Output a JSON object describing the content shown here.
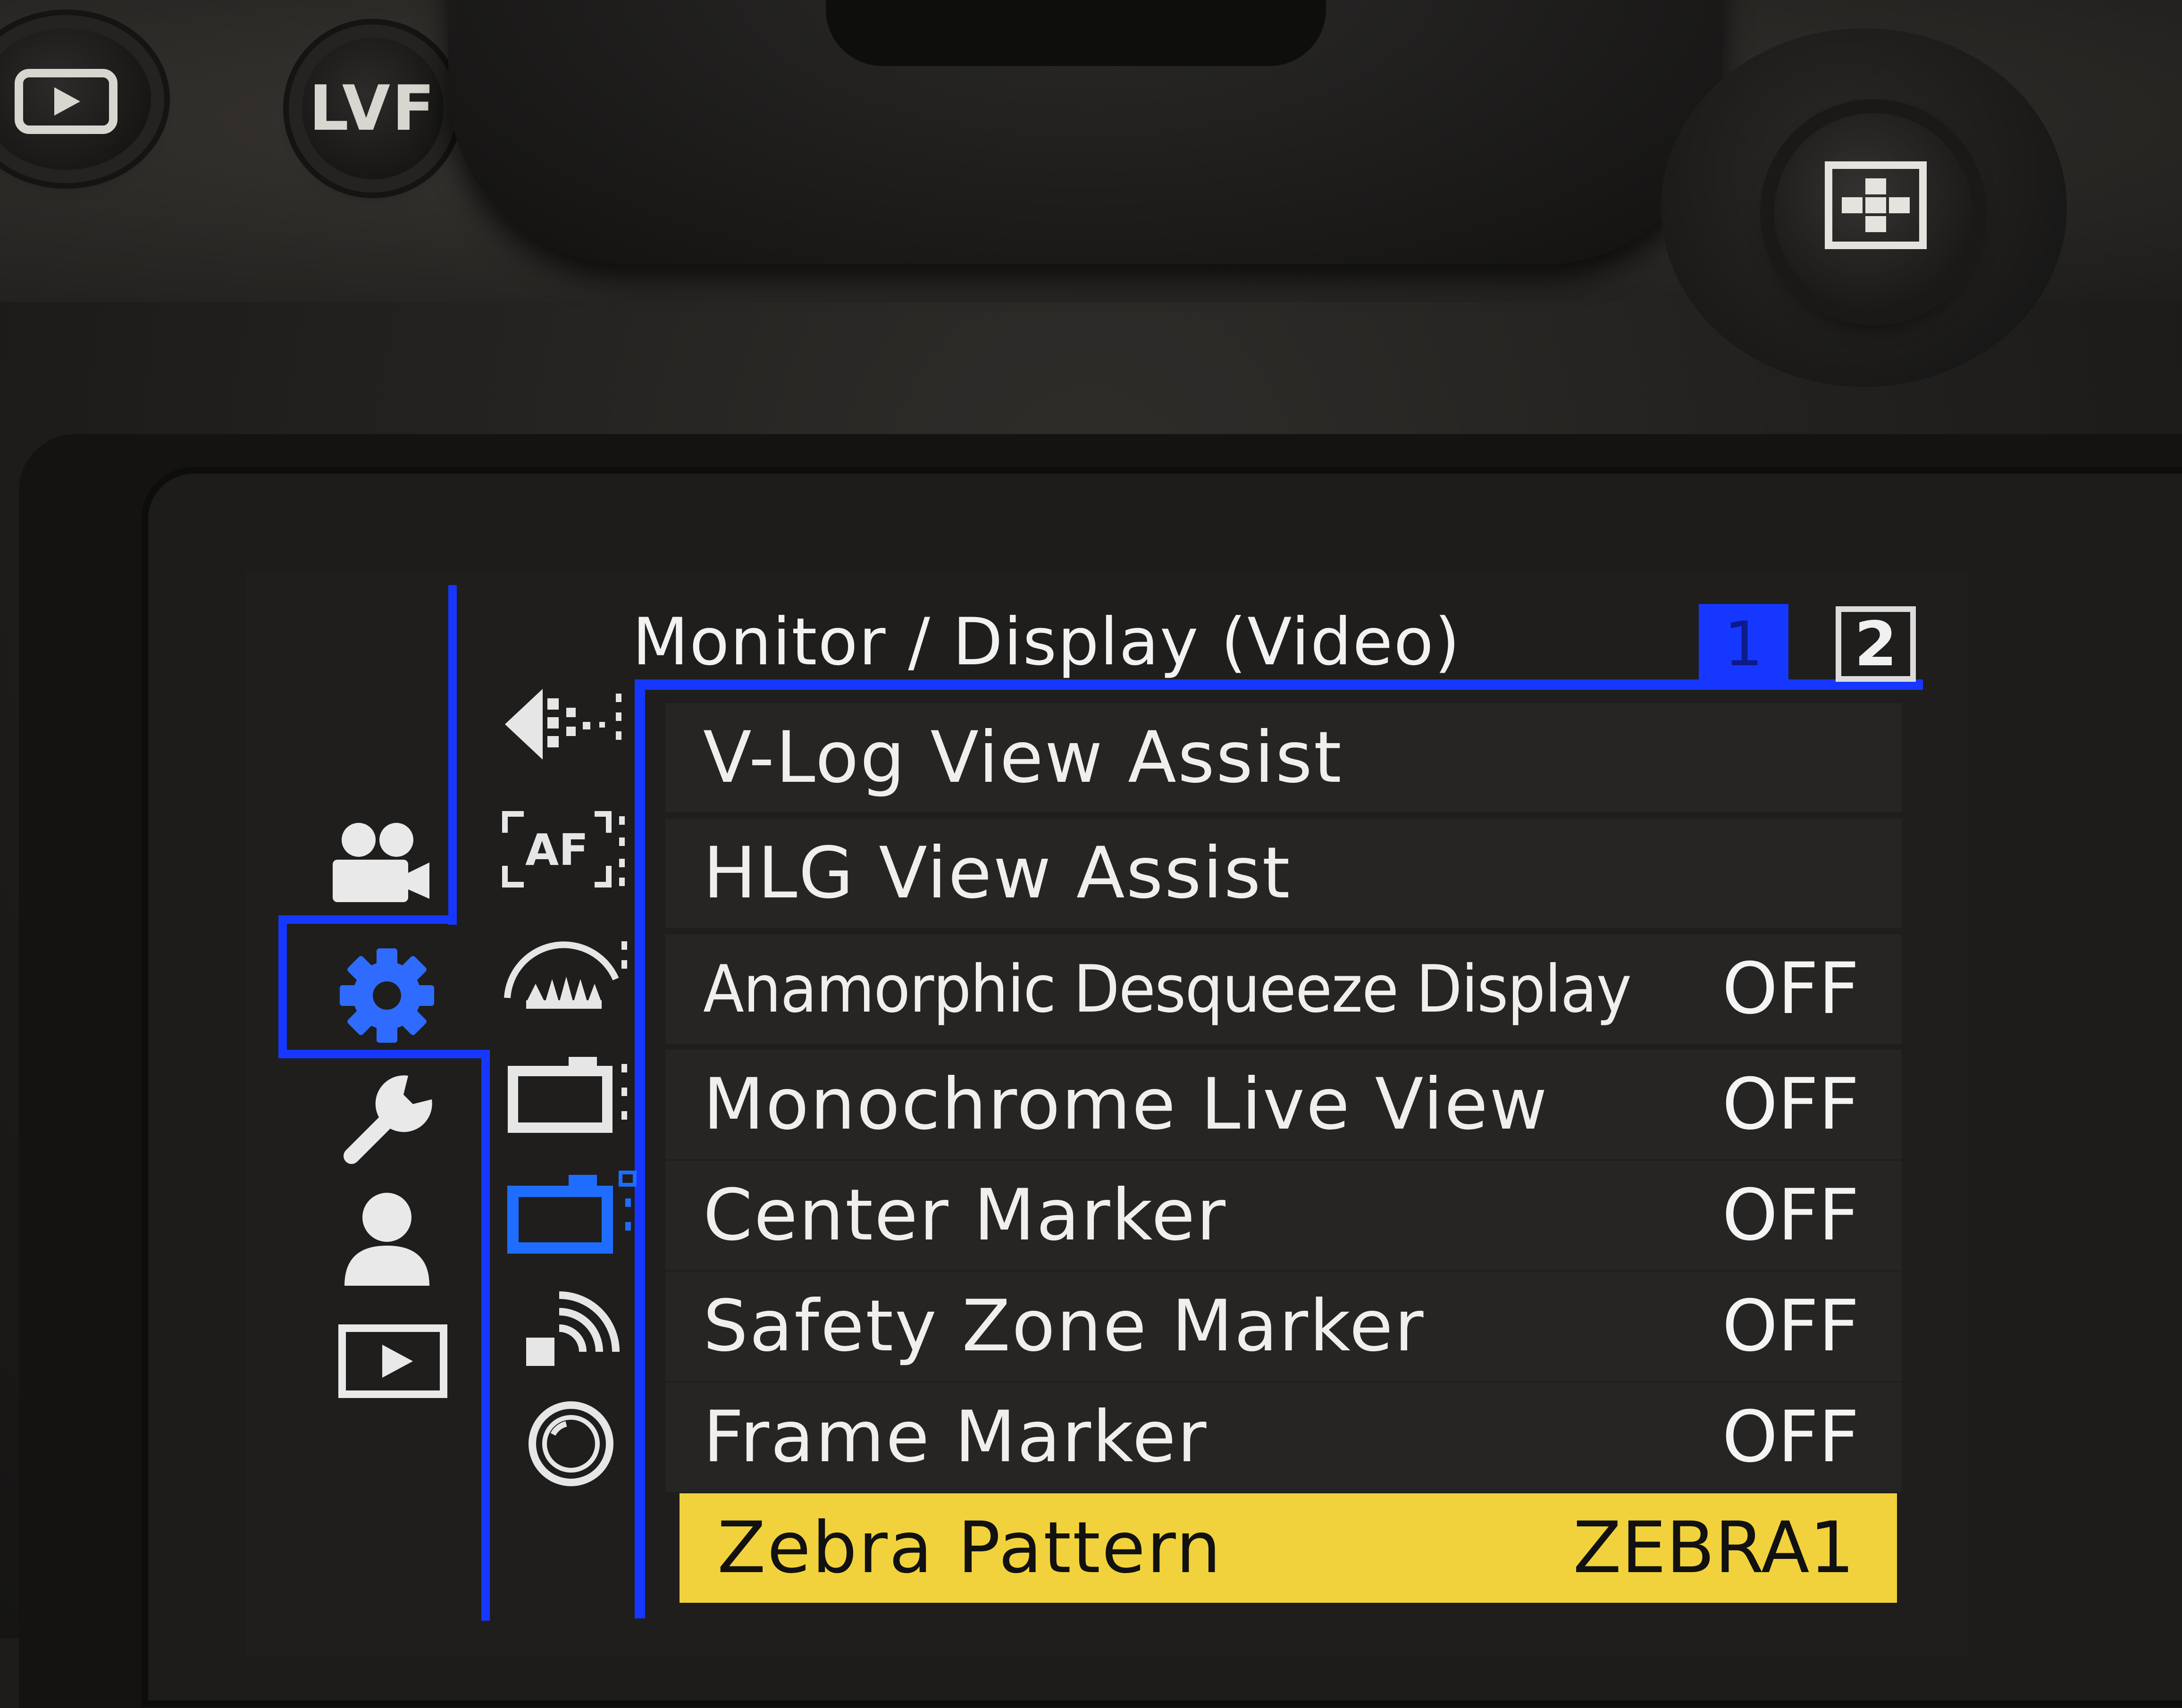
{
  "hardware": {
    "lvf_label": "LVF"
  },
  "screen": {
    "menu_title": "Monitor / Display (Video)",
    "pages": [
      "1",
      "2"
    ],
    "active_page": "1",
    "categories": [
      {
        "name": "video-camera-icon",
        "active": false
      },
      {
        "name": "gear-icon",
        "active": true
      },
      {
        "name": "wrench-icon",
        "active": false
      },
      {
        "name": "person-icon",
        "active": false
      },
      {
        "name": "playback-icon",
        "active": false
      }
    ],
    "sub_tabs": [
      {
        "name": "image-quality-icon",
        "active": false
      },
      {
        "name": "af-icon",
        "active": false
      },
      {
        "name": "exposure-meter-icon",
        "active": false
      },
      {
        "name": "camera-monitor-icon",
        "active": false
      },
      {
        "name": "camera-monitor-video-icon",
        "active": true
      },
      {
        "name": "wireless-icon",
        "active": false
      },
      {
        "name": "lens-icon",
        "active": false
      }
    ],
    "items": [
      {
        "label": "V-Log View Assist",
        "value": ""
      },
      {
        "label": "HLG View Assist",
        "value": ""
      },
      {
        "label": "Anamorphic Desqueeze Display",
        "value": "OFF"
      },
      {
        "label": "Monochrome Live View",
        "value": "OFF"
      },
      {
        "label": "Center Marker",
        "value": "OFF"
      },
      {
        "label": "Safety Zone Marker",
        "value": "OFF"
      },
      {
        "label": "Frame Marker",
        "value": "OFF"
      },
      {
        "label": "Zebra Pattern",
        "value": "ZEBRA1"
      }
    ],
    "selected_item": "Zebra Pattern",
    "colors": {
      "accent_blue": "#1637ff",
      "selection_yellow": "#f1d23c",
      "row_background": "#262524",
      "text": "#f0efee"
    }
  }
}
